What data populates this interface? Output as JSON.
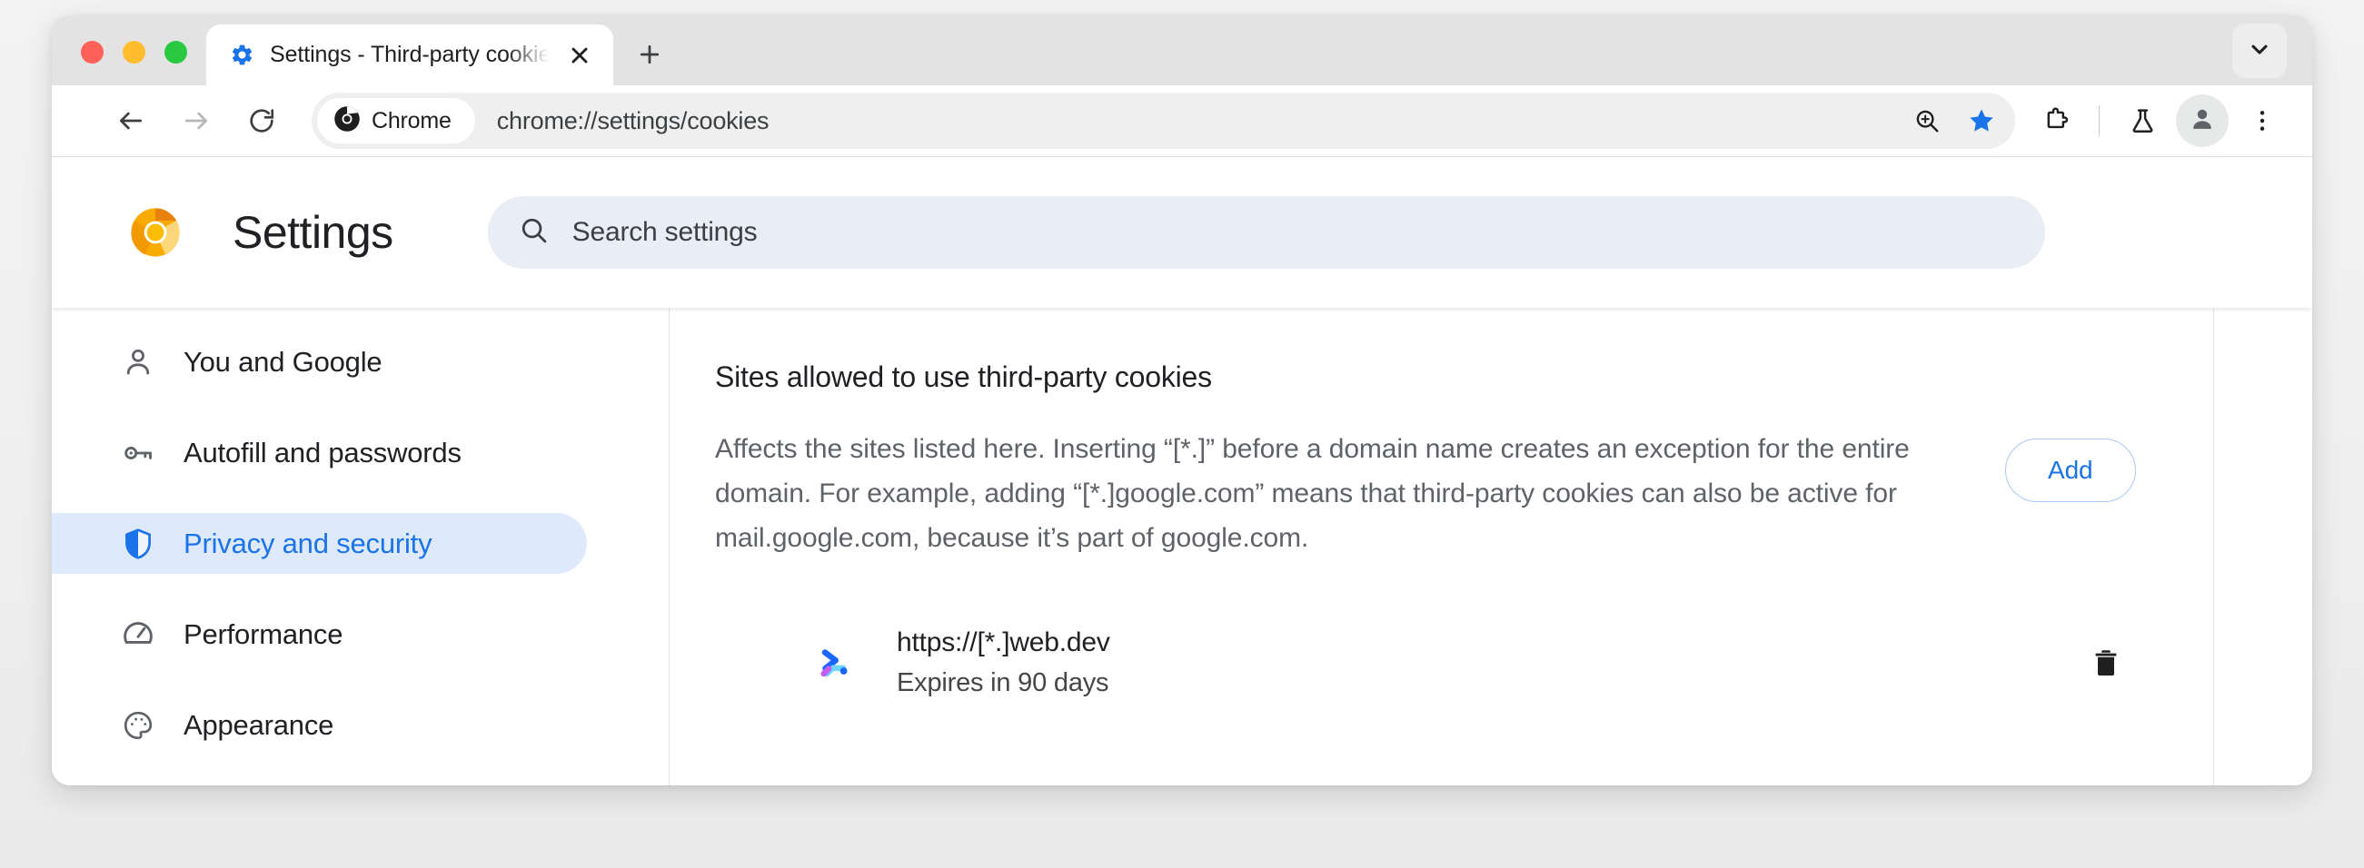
{
  "window": {
    "traffic_lights": [
      {
        "name": "close",
        "color": "#ff6159"
      },
      {
        "name": "minimize",
        "color": "#ffbd2e"
      },
      {
        "name": "maximize",
        "color": "#28c93f"
      }
    ]
  },
  "tabstrip": {
    "tabs": [
      {
        "title": "Settings - Third-party cookies",
        "favicon": "gear-icon",
        "active": true
      }
    ],
    "new_tab_label": "+",
    "tab_search_icon": "chevron-down-icon"
  },
  "toolbar": {
    "back_icon": "arrow-left-icon",
    "forward_icon": "arrow-right-icon",
    "reload_icon": "reload-icon",
    "site_chip_label": "Chrome",
    "site_chip_icon": "chrome-icon",
    "url": "chrome://settings/cookies",
    "zoom_icon": "zoom-in-icon",
    "bookmark_icon": "star-filled-icon",
    "extensions_icon": "puzzle-piece-icon",
    "experiments_icon": "flask-icon",
    "profile_icon": "person-icon",
    "menu_icon": "three-dot-menu-icon",
    "accent_color": "#1a73e8"
  },
  "settings": {
    "logo": "chrome-canary-icon",
    "title": "Settings",
    "search": {
      "icon": "search-icon",
      "placeholder": "Search settings",
      "value": ""
    },
    "sidebar": {
      "items": [
        {
          "label": "You and Google",
          "icon": "person-icon",
          "selected": false
        },
        {
          "label": "Autofill and passwords",
          "icon": "key-icon",
          "selected": false
        },
        {
          "label": "Privacy and security",
          "icon": "shield-icon",
          "selected": true
        },
        {
          "label": "Performance",
          "icon": "speedometer-icon",
          "selected": false
        },
        {
          "label": "Appearance",
          "icon": "palette-icon",
          "selected": false
        }
      ],
      "selected_color": "#1a73e8",
      "selected_background": "#dfe9fc"
    },
    "content": {
      "heading": "Sites allowed to use third-party cookies",
      "description": "Affects the sites listed here. Inserting “[*.]” before a domain name creates an exception for the entire domain. For example, adding “[*.]google.com” means that third-party cookies can also be active for mail.google.com, because it’s part of google.com.",
      "add_button_label": "Add",
      "sites": [
        {
          "url": "https://[*.]web.dev",
          "expiry": "Expires in 90 days",
          "favicon": "webdev-icon",
          "delete_icon": "trash-icon"
        }
      ]
    }
  }
}
